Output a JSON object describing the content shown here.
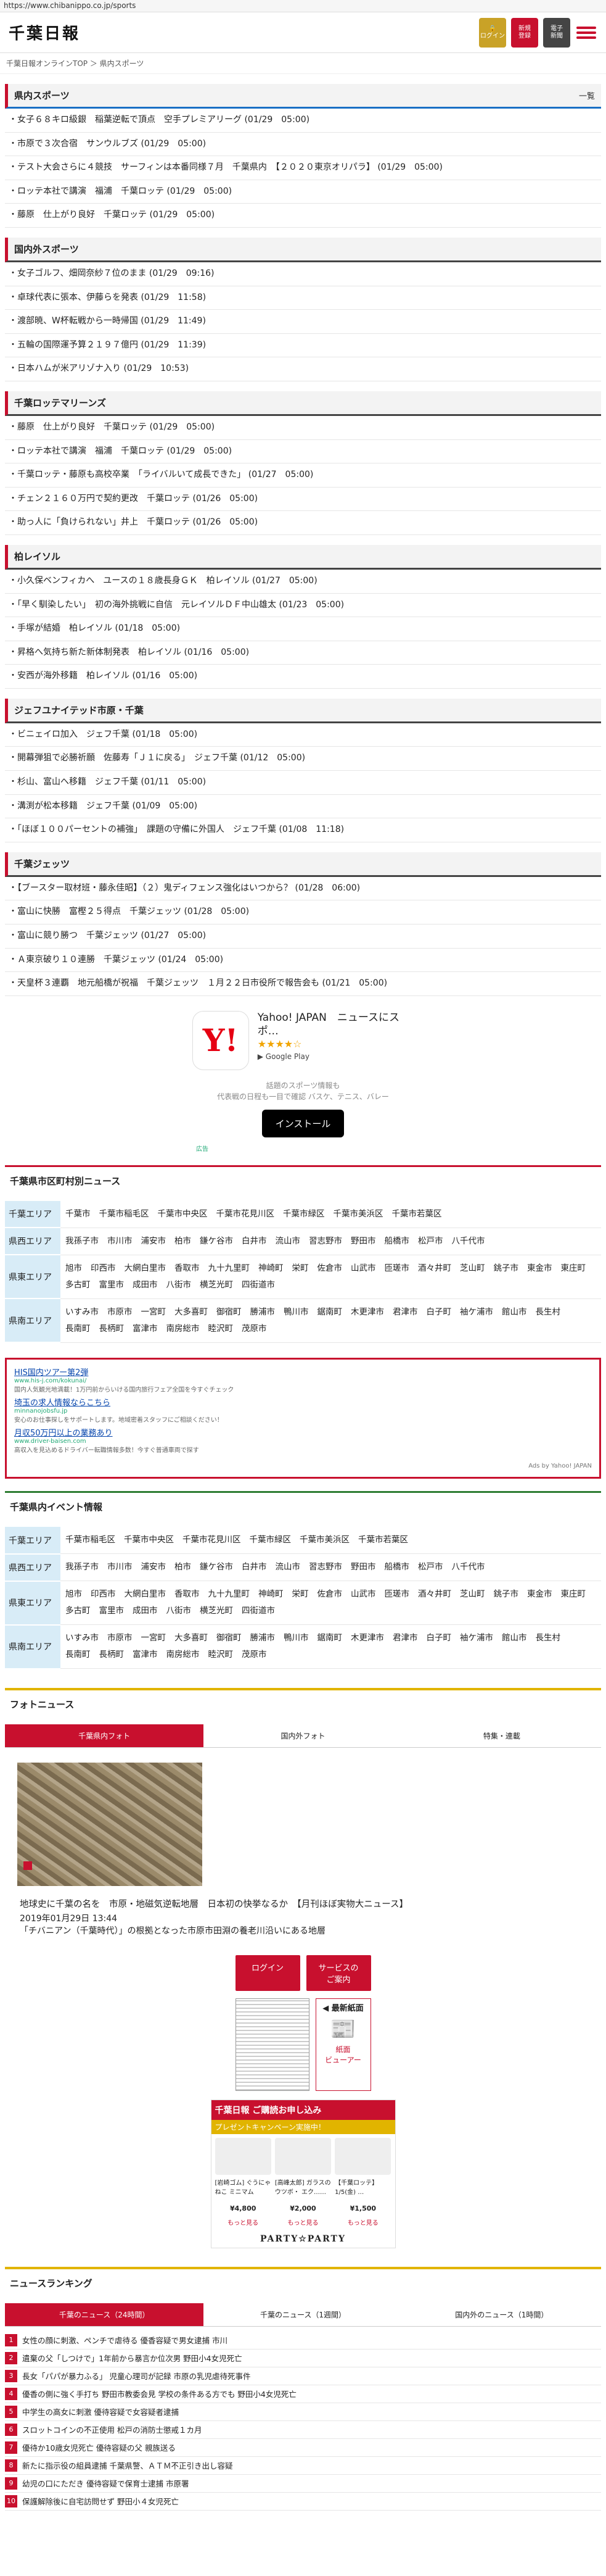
{
  "url": "https://www.chibanippo.co.jp/sports",
  "header": {
    "logo": "千葉日報",
    "login": "ログイン",
    "register": "新規\n登録",
    "epaper": "電子\n新聞"
  },
  "breadcrumb": "千葉日報オンラインTOP ＞ 県内スポーツ",
  "sections": [
    {
      "title": "県内スポーツ",
      "more": "一覧",
      "items": [
        "女子６８キロ級銀　稲葉逆転で頂点　空手プレミアリーグ (01/29　05:00)",
        "市原で３次合宿　サンウルブズ (01/29　05:00)",
        "テスト大会さらに４競技　サーフィンは本番同様７月　千葉県内　【２０２０東京オリパラ】 (01/29　05:00)",
        "ロッテ本社で講演　福浦　千葉ロッテ (01/29　05:00)",
        "藤原　仕上がり良好　千葉ロッテ (01/29　05:00)"
      ]
    },
    {
      "title": "国内外スポーツ",
      "more": "",
      "items": [
        "女子ゴルフ、畑岡奈紗７位のまま (01/29　09:16)",
        "卓球代表に張本、伊藤らを発表 (01/29　11:58)",
        "渡部暁、W杯転戦から一時帰国 (01/29　11:49)",
        "五輪の国際運予算２１９７億円 (01/29　11:39)",
        "日本ハムが米アリゾナ入り (01/29　10:53)"
      ]
    },
    {
      "title": "千葉ロッテマリーンズ",
      "more": "",
      "items": [
        "藤原　仕上がり良好　千葉ロッテ (01/29　05:00)",
        "ロッテ本社で講演　福浦　千葉ロッテ (01/29　05:00)",
        "千葉ロッテ・藤原も高校卒業　「ライバルいて成長できた」 (01/27　05:00)",
        "チェン２１６０万円で契約更改　千葉ロッテ (01/26　05:00)",
        "助っ人に「負けられない」井上　千葉ロッテ (01/26　05:00)"
      ]
    },
    {
      "title": "柏レイソル",
      "more": "",
      "items": [
        "小久保ベンフィカへ　ユースの１８歳長身ＧＫ　柏レイソル (01/27　05:00)",
        "「早く馴染したい」　初の海外挑戦に自信　元レイソルＤＦ中山雄太 (01/23　05:00)",
        "手塚が結婚　柏レイソル (01/18　05:00)",
        "昇格へ気持ち新た新体制発表　柏レイソル (01/16　05:00)",
        "安西が海外移籍　柏レイソル (01/16　05:00)"
      ]
    },
    {
      "title": "ジェフユナイテッド市原・千葉",
      "more": "",
      "items": [
        "ビニェイロ加入　ジェフ千葉 (01/18　05:00)",
        "開幕弾狙で必勝祈願　佐藤寿「Ｊ１に戻る」　ジェフ千葉 (01/12　05:00)",
        "杉山、富山へ移籍　ジェフ千葉 (01/11　05:00)",
        "溝渕が松本移籍　ジェフ千葉 (01/09　05:00)",
        "「ほぼ１００パーセントの補強」　課題の守備に外国人　ジェフ千葉 (01/08　11:18)"
      ]
    },
    {
      "title": "千葉ジェッツ",
      "more": "",
      "items": [
        "【ブースター取材班・藤永佳昭】（２）鬼ディフェンス強化はいつから？ (01/28　06:00)",
        "富山に快勝　富樫２５得点　千葉ジェッツ (01/28　05:00)",
        "富山に競り勝つ　千葉ジェッツ (01/27　05:00)",
        "Ａ東京破り１０連勝　千葉ジェッツ (01/24　05:00)",
        "天皇杯３連覇　地元船橋が祝福　千葉ジェッツ　１月２２日市役所で報告会も (01/21　05:00)"
      ]
    }
  ],
  "app_ad": {
    "logo": "Y!",
    "name": "Yahoo! JAPAN　ニュースにスポ…",
    "stars": "★★★★☆",
    "store": "Google Play",
    "desc1": "話題のスポーツ情報も",
    "desc2": "代表戦の日程も一目で確認 バスケ、テニス、バレー",
    "install": "インストール",
    "mark": "広告"
  },
  "city_news": {
    "title": "千葉県市区町村別ニュース",
    "areas": [
      {
        "name": "千葉エリア",
        "cities": [
          "千葉市",
          "千葉市稲毛区",
          "千葉市中央区",
          "千葉市花見川区",
          "千葉市緑区",
          "千葉市美浜区",
          "千葉市若葉区"
        ]
      },
      {
        "name": "県西エリア",
        "cities": [
          "我孫子市",
          "市川市",
          "浦安市",
          "柏市",
          "鎌ケ谷市",
          "白井市",
          "流山市",
          "習志野市",
          "野田市",
          "船橋市",
          "松戸市",
          "八千代市"
        ]
      },
      {
        "name": "県東エリア",
        "cities": [
          "旭市",
          "印西市",
          "大網白里市",
          "香取市",
          "九十九里町",
          "神崎町",
          "栄町",
          "佐倉市",
          "山武市",
          "匝瑳市",
          "酒々井町",
          "芝山町",
          "銚子市",
          "東金市",
          "東庄町",
          "多古町",
          "富里市",
          "成田市",
          "八街市",
          "横芝光町",
          "四街道市"
        ]
      },
      {
        "name": "県南エリア",
        "cities": [
          "いすみ市",
          "市原市",
          "一宮町",
          "大多喜町",
          "御宿町",
          "勝浦市",
          "鴨川市",
          "鋸南町",
          "木更津市",
          "君津市",
          "白子町",
          "袖ケ浦市",
          "館山市",
          "長生村",
          "長南町",
          "長柄町",
          "富津市",
          "南房総市",
          "睦沢町",
          "茂原市"
        ]
      }
    ]
  },
  "text_ads": {
    "items": [
      {
        "title": "HIS国内ツアー第2弾",
        "url": "www.his-j.com/kokunai/",
        "desc": "国内人気観光地満載！1万円前からいける国内旅行フェア全国を今すぐチェック"
      },
      {
        "title": "埼玉の求人情報ならこちら",
        "url": "minnanojobsfu.jp",
        "desc": "安心のお仕事探しをサポートします。地域密着スタッフにご相談ください！"
      },
      {
        "title": "月収50万円以上の業務あり",
        "url": "www.driver-baisen.com",
        "desc": "高収入を見込めるドライバー転職情報多数！今すぐ普通車両で探す"
      }
    ],
    "by": "Ads by Yahoo! JAPAN"
  },
  "event_info": {
    "title": "千葉県内イベント情報",
    "areas": [
      {
        "name": "千葉エリア",
        "cities": [
          "千葉市稲毛区",
          "千葉市中央区",
          "千葉市花見川区",
          "千葉市緑区",
          "千葉市美浜区",
          "千葉市若葉区"
        ]
      },
      {
        "name": "県西エリア",
        "cities": [
          "我孫子市",
          "市川市",
          "浦安市",
          "柏市",
          "鎌ケ谷市",
          "白井市",
          "流山市",
          "習志野市",
          "野田市",
          "船橋市",
          "松戸市",
          "八千代市"
        ]
      },
      {
        "name": "県東エリア",
        "cities": [
          "旭市",
          "印西市",
          "大網白里市",
          "香取市",
          "九十九里町",
          "神崎町",
          "栄町",
          "佐倉市",
          "山武市",
          "匝瑳市",
          "酒々井町",
          "芝山町",
          "銚子市",
          "東金市",
          "東庄町",
          "多古町",
          "富里市",
          "成田市",
          "八街市",
          "横芝光町",
          "四街道市"
        ]
      },
      {
        "name": "県南エリア",
        "cities": [
          "いすみ市",
          "市原市",
          "一宮町",
          "大多喜町",
          "御宿町",
          "勝浦市",
          "鴨川市",
          "鋸南町",
          "木更津市",
          "君津市",
          "白子町",
          "袖ケ浦市",
          "館山市",
          "長生村",
          "長南町",
          "長柄町",
          "富津市",
          "南房総市",
          "睦沢町",
          "茂原市"
        ]
      }
    ]
  },
  "photo_news": {
    "title": "フォトニュース",
    "tabs": [
      "千葉県内フォト",
      "国内外フォト",
      "特集・連載"
    ],
    "caption": "地球史に千葉の名を　市原・地磁気逆転地層　日本初の快挙なるか　【月刊ほぼ実物大ニュース】",
    "date": "2019年01月29日 13:44",
    "sub": "「チバニアン（千葉時代）」の根拠となった市原市田淵の養老川沿いにある地層"
  },
  "sidebar": {
    "login": "ログイン",
    "service": "サービスの\nご案内",
    "latest": "◀ 最新紙面",
    "viewer": "紙面\nビューアー",
    "promo_title": "千葉日報 ご購読お申し込み",
    "promo_sub": "プレゼントキャンペーン実施中！",
    "products": [
      {
        "name": "[岩崎ゴム] ぐうにゃ ねこ ミニマム",
        "price": "¥4,800",
        "more": "もっと見る"
      },
      {
        "name": "[高峰太郎] ガラスのウツボ・ エク……",
        "price": "¥2,000",
        "more": "もっと見る"
      },
      {
        "name": "【千葉ロッテ】 1/5(金) …",
        "price": "¥1,500",
        "more": "もっと見る"
      }
    ],
    "party": "PARTY☆PARTY"
  },
  "ranking": {
    "title": "ニュースランキング",
    "tabs": [
      "千葉のニュース（24時間）",
      "千葉のニュース（1週間）",
      "国内外のニュース（1時間）"
    ],
    "items": [
      "女性の顔に刺激、ペンチで虐待る 優香容疑で男女逮捕 市川",
      "遺棄の父「しつけで」1年前から暴言か位次男 野田小4女児死亡",
      "長女「パパが暴力ふる」 児童心理司が記録 市原の乳児虐待死事件",
      "優香の側に強く手打ち 野田市教委会見 学校の条件ある方でも 野田小4女児死亡",
      "中学生の高女に刺激 優待容疑で女容疑者逮捕",
      "スロットコインの不正使用 松戸の消防士懲戒１カ月",
      "優待か10歳女児死亡 優待容疑の父 親族送る",
      "新たに指示役の組員逮捕 千葉県警、ＡＴＭ不正引き出し容疑",
      "幼児の口にただき 優待容疑で保育士逮捕 市原署",
      "保護解除後に自宅訪問せず 野田小４女児死亡"
    ]
  }
}
